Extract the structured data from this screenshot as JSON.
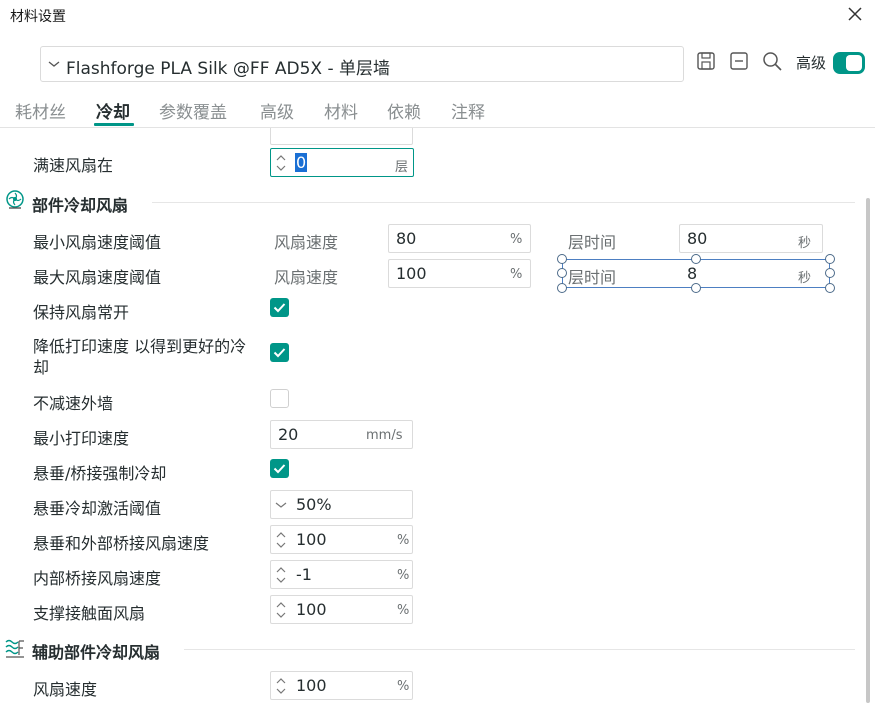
{
  "window": {
    "title": "材料设置"
  },
  "preset": {
    "value": "Flashforge PLA Silk @FF AD5X - 单层墙"
  },
  "toolbar": {
    "advanced_label": "高级"
  },
  "tabs": [
    "耗材丝",
    "冷却",
    "参数覆盖",
    "高级",
    "材料",
    "依赖",
    "注释"
  ],
  "active_tab": "冷却",
  "top": {
    "full_fan_label": "满速风扇在",
    "full_fan_value": "0",
    "full_fan_unit": "层"
  },
  "part_cooling": {
    "title": "部件冷却风扇",
    "min_threshold": {
      "label": "最小风扇速度阈值",
      "fan_speed_label": "风扇速度",
      "fan_speed_value": "80",
      "fan_speed_unit": "%",
      "layer_time_label": "层时间",
      "layer_time_value": "80",
      "layer_time_unit": "秒"
    },
    "max_threshold": {
      "label": "最大风扇速度阈值",
      "fan_speed_label": "风扇速度",
      "fan_speed_value": "100",
      "fan_speed_unit": "%",
      "layer_time_label": "层时间",
      "layer_time_value": "8",
      "layer_time_unit": "秒"
    },
    "keep_fan_on": {
      "label": "保持风扇常开",
      "checked": true
    },
    "slow_down": {
      "label_line1": "降低打印速度 以得到更好的冷",
      "label_line2": "却",
      "checked": true
    },
    "dont_slow_outer": {
      "label": "不减速外墙",
      "checked": false
    },
    "min_print_speed": {
      "label": "最小打印速度",
      "value": "20",
      "unit": "mm/s"
    },
    "overhang_force": {
      "label": "悬垂/桥接强制冷却",
      "checked": true
    },
    "overhang_threshold": {
      "label": "悬垂冷却激活阈值",
      "value": "50%"
    },
    "overhang_bridge_fan": {
      "label": "悬垂和外部桥接风扇速度",
      "value": "100",
      "unit": "%"
    },
    "internal_bridge_fan": {
      "label": "内部桥接风扇速度",
      "value": "-1",
      "unit": "%"
    },
    "support_interface_fan": {
      "label": "支撑接触面风扇",
      "value": "100",
      "unit": "%"
    }
  },
  "aux_cooling": {
    "title": "辅助部件冷却风扇",
    "fan_speed": {
      "label": "风扇速度",
      "value": "100",
      "unit": "%"
    }
  },
  "colors": {
    "accent": "#009688",
    "selection": "#1a6fd4"
  }
}
